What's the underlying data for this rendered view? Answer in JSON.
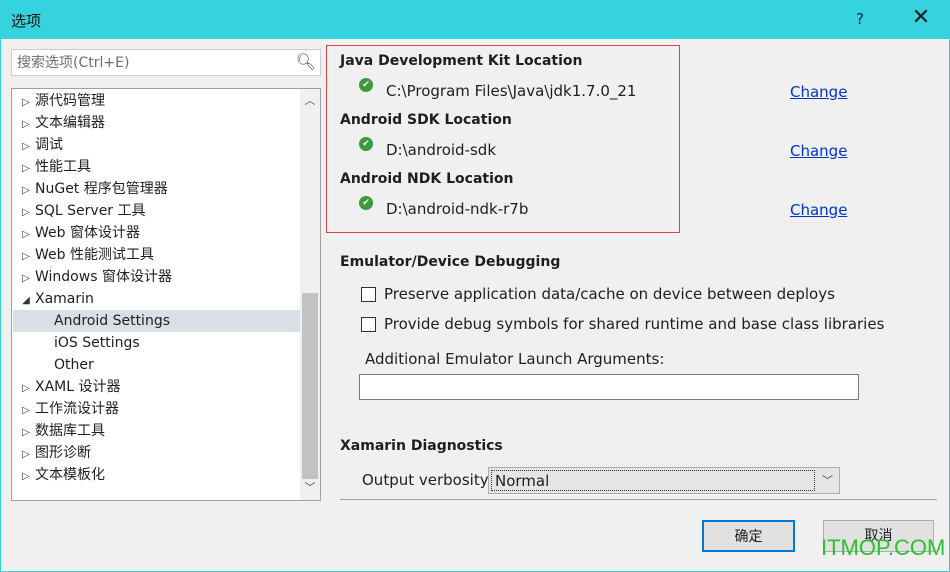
{
  "window": {
    "title": "选项",
    "help": "?",
    "close": "✕"
  },
  "search": {
    "placeholder": "搜索选项(Ctrl+E)"
  },
  "tree": [
    {
      "label": "源代码管理",
      "expander": "▷",
      "level": 0
    },
    {
      "label": "文本编辑器",
      "expander": "▷",
      "level": 0
    },
    {
      "label": "调试",
      "expander": "▷",
      "level": 0
    },
    {
      "label": "性能工具",
      "expander": "▷",
      "level": 0
    },
    {
      "label": "NuGet 程序包管理器",
      "expander": "▷",
      "level": 0
    },
    {
      "label": "SQL Server 工具",
      "expander": "▷",
      "level": 0
    },
    {
      "label": "Web 窗体设计器",
      "expander": "▷",
      "level": 0
    },
    {
      "label": "Web 性能测试工具",
      "expander": "▷",
      "level": 0
    },
    {
      "label": "Windows 窗体设计器",
      "expander": "▷",
      "level": 0
    },
    {
      "label": "Xamarin",
      "expander": "◢",
      "level": 0
    },
    {
      "label": "Android Settings",
      "expander": "",
      "level": 1,
      "selected": true
    },
    {
      "label": "iOS Settings",
      "expander": "",
      "level": 1
    },
    {
      "label": "Other",
      "expander": "",
      "level": 1
    },
    {
      "label": "XAML 设计器",
      "expander": "▷",
      "level": 0
    },
    {
      "label": "工作流设计器",
      "expander": "▷",
      "level": 0
    },
    {
      "label": "数据库工具",
      "expander": "▷",
      "level": 0
    },
    {
      "label": "图形诊断",
      "expander": "▷",
      "level": 0
    },
    {
      "label": "文本模板化",
      "expander": "▷",
      "level": 0
    }
  ],
  "locations": [
    {
      "heading": "Java Development Kit Location",
      "path": "C:\\Program Files\\Java\\jdk1.7.0_21",
      "status": "ok",
      "link": "Change"
    },
    {
      "heading": "Android SDK Location",
      "path": "D:\\android-sdk",
      "status": "ok",
      "link": "Change"
    },
    {
      "heading": "Android NDK Location",
      "path": "D:\\android-ndk-r7b",
      "status": "ok",
      "link": "Change"
    }
  ],
  "emulator": {
    "heading": "Emulator/Device Debugging",
    "options": [
      {
        "label": "Preserve application data/cache on device between deploys",
        "checked": false
      },
      {
        "label": "Provide debug symbols for shared runtime and base class libraries",
        "checked": false
      }
    ],
    "args_label": "Additional Emulator Launch Arguments:",
    "args_value": ""
  },
  "diagnostics": {
    "heading": "Xamarin Diagnostics",
    "verbosity_label": "Output verbosity:",
    "verbosity_value": "Normal"
  },
  "buttons": {
    "ok": "确定",
    "cancel": "取消"
  },
  "watermark": "ITMOP.COM",
  "colors": {
    "titlebar": "#35d3de",
    "highlight_box": "#d9464a",
    "ok_icon": "#3c9a3c",
    "link": "#0033cc",
    "watermark": "#2fc02f"
  }
}
